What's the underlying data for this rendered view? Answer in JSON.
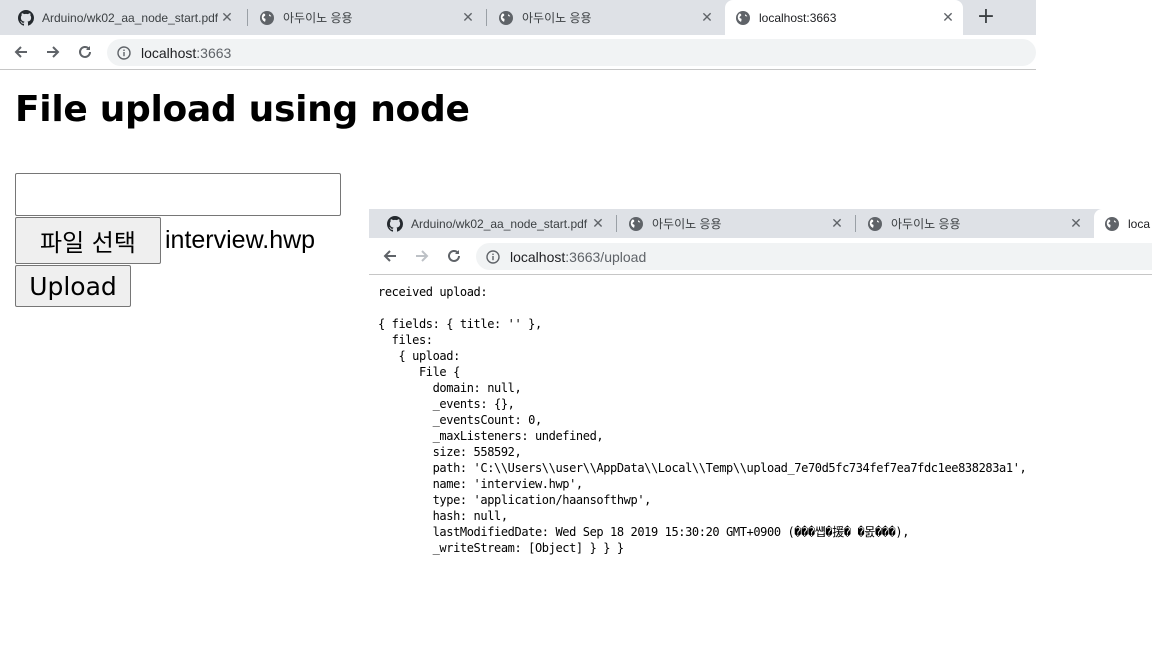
{
  "main_window": {
    "tabs": [
      {
        "title": "Arduino/wk02_aa_node_start.pdf",
        "favicon": "github-icon"
      },
      {
        "title": "아두이노 응용",
        "favicon": "globe-icon"
      },
      {
        "title": "아두이노 응용",
        "favicon": "globe-icon"
      },
      {
        "title": "localhost:3663",
        "favicon": "globe-icon",
        "active": true
      }
    ],
    "new_tab_label": "+",
    "address": {
      "host": "localhost",
      "port": ":3663"
    }
  },
  "page": {
    "heading": "File upload using node",
    "title_input_value": "",
    "file_button_label": "파일 선택",
    "selected_file": "interview.hwp",
    "upload_button_label": "Upload"
  },
  "second_window": {
    "tabs": [
      {
        "title": "Arduino/wk02_aa_node_start.pdf",
        "favicon": "github-icon"
      },
      {
        "title": "아두이노 응용",
        "favicon": "globe-icon"
      },
      {
        "title": "아두이노 응용",
        "favicon": "globe-icon"
      },
      {
        "title": "loca",
        "favicon": "globe-icon",
        "active": true
      }
    ],
    "address": {
      "host": "localhost",
      "rest": ":3663/upload"
    },
    "output_text": "received upload:\n\n{ fields: { title: '' },\n  files:\n   { upload:\n      File {\n        domain: null,\n        _events: {},\n        _eventsCount: 0,\n        _maxListeners: undefined,\n        size: 558592,\n        path: 'C:\\\\Users\\\\user\\\\AppData\\\\Local\\\\Temp\\\\upload_7e70d5fc734fef7ea7fdc1ee838283a1',\n        name: 'interview.hwp',\n        type: 'application/haansofthwp',\n        hash: null,\n        lastModifiedDate: Wed Sep 18 2019 15:30:20 GMT+0900 (���썝�援� �몴���),\n        _writeStream: [Object] } } }"
  },
  "colors": {
    "tab_strip": "#dee1e6",
    "omnibox": "#f1f3f4",
    "button_face": "#efefef",
    "icon": "#5f6368"
  }
}
